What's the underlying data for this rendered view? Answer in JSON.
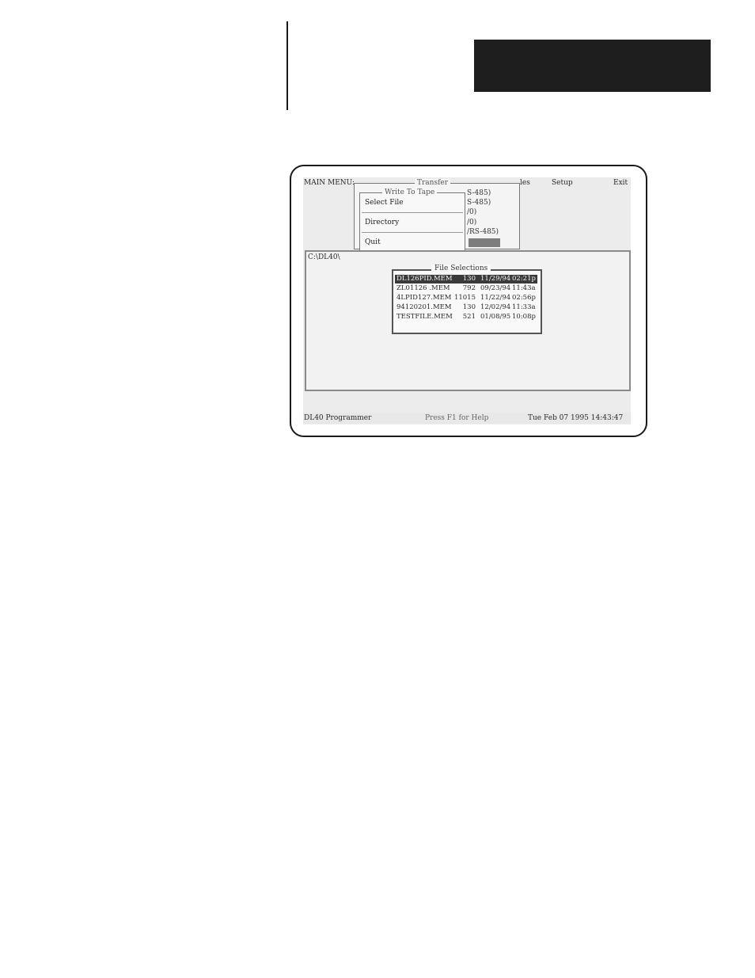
{
  "main_menu": {
    "label": "MAIN MENU:",
    "visible_items": [
      "les",
      "Setup",
      "Exit"
    ]
  },
  "transfer_menu": {
    "title": "Transfer",
    "submenu": {
      "title": "Write To Tape",
      "items": [
        "Select File",
        "Directory",
        "Quit"
      ]
    },
    "port_fragments": [
      "S-485)",
      "S-485)",
      "/0)",
      "/0)",
      "/RS-485)"
    ]
  },
  "workspace": {
    "path": "C:\\DL40\\"
  },
  "file_selections": {
    "title": "File Selections",
    "files": [
      {
        "name": "DL126PID.MEM",
        "size": "130",
        "date": "11/29/94",
        "time": "02:21p",
        "selected": true
      },
      {
        "name": "ZL01126 .MEM",
        "size": "792",
        "date": "09/23/94",
        "time": "11:43a",
        "selected": false
      },
      {
        "name": "4LPID127.MEM",
        "size": "11015",
        "date": "11/22/94",
        "time": "02:56p",
        "selected": false
      },
      {
        "name": "94120201.MEM",
        "size": "130",
        "date": "12/02/94",
        "time": "11:33a",
        "selected": false
      },
      {
        "name": "TESTFILE.MEM",
        "size": "521",
        "date": "01/08/95",
        "time": "10:08p",
        "selected": false
      }
    ]
  },
  "status_bar": {
    "app": "DL40 Programmer",
    "help": "Press F1 for Help",
    "datetime": "Tue Feb 07 1995 14:43:47"
  }
}
